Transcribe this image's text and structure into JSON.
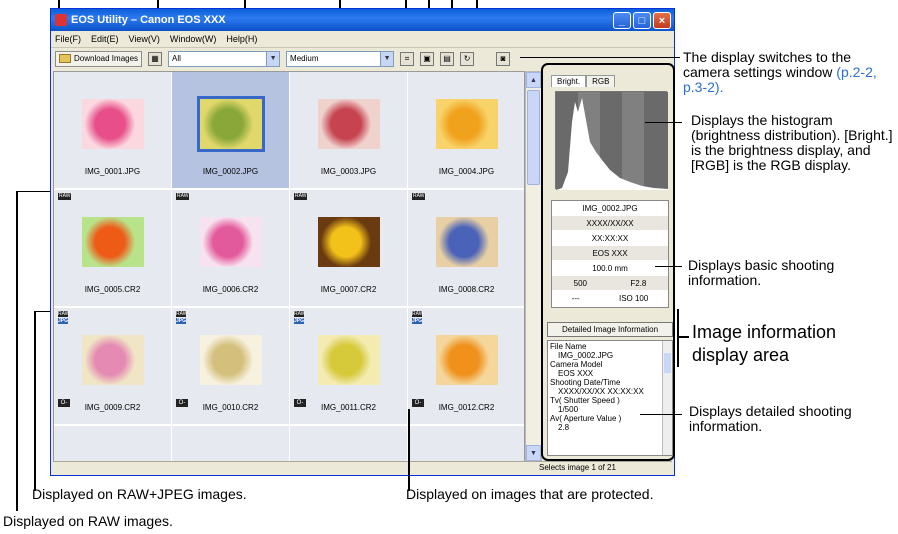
{
  "window": {
    "title": "EOS Utility – Canon EOS XXX",
    "controls": [
      "_",
      "□",
      "×"
    ]
  },
  "menu": [
    "File(F)",
    "Edit(E)",
    "View(V)",
    "Window(W)",
    "Help(H)"
  ],
  "toolbar": {
    "download_label": "Download Images",
    "filter_value": "All",
    "size_value": "Medium"
  },
  "thumbnails": [
    {
      "file": "IMG_0001.JPG",
      "badge": "",
      "lock": false,
      "selected": false,
      "colors": [
        "#e84f8a",
        "#fbd7e0"
      ]
    },
    {
      "file": "IMG_0002.JPG",
      "badge": "",
      "lock": false,
      "selected": true,
      "colors": [
        "#8aa83a",
        "#e0d86a"
      ]
    },
    {
      "file": "IMG_0003.JPG",
      "badge": "",
      "lock": false,
      "selected": false,
      "colors": [
        "#c6434f",
        "#f0d2cd"
      ]
    },
    {
      "file": "IMG_0004.JPG",
      "badge": "",
      "lock": false,
      "selected": false,
      "colors": [
        "#f0a21c",
        "#f7d36a"
      ]
    },
    {
      "file": "IMG_0005.CR2",
      "badge": "RAW",
      "lock": false,
      "selected": false,
      "colors": [
        "#ee5b17",
        "#b9e38a"
      ]
    },
    {
      "file": "IMG_0006.CR2",
      "badge": "RAW",
      "lock": false,
      "selected": false,
      "colors": [
        "#e35a9c",
        "#f7e3ef"
      ]
    },
    {
      "file": "IMG_0007.CR2",
      "badge": "RAW",
      "lock": false,
      "selected": false,
      "colors": [
        "#f2c11a",
        "#6a3a10"
      ]
    },
    {
      "file": "IMG_0008.CR2",
      "badge": "RAW",
      "lock": false,
      "selected": false,
      "colors": [
        "#4a63b8",
        "#e8d0a4"
      ]
    },
    {
      "file": "IMG_0009.CR2",
      "badge": "RAW+JPEG",
      "lock": true,
      "selected": false,
      "colors": [
        "#e58ab2",
        "#f0e6c6"
      ]
    },
    {
      "file": "IMG_0010.CR2",
      "badge": "RAW+JPEG",
      "lock": true,
      "selected": false,
      "colors": [
        "#d4c07c",
        "#f7f1df"
      ]
    },
    {
      "file": "IMG_0011.CR2",
      "badge": "RAW+JPEG",
      "lock": true,
      "selected": false,
      "colors": [
        "#d6c93a",
        "#f3ebb2"
      ]
    },
    {
      "file": "IMG_0012.CR2",
      "badge": "RAW+JPEG",
      "lock": true,
      "selected": false,
      "colors": [
        "#f0911c",
        "#f5d79b"
      ]
    },
    {
      "file": "",
      "badge": "",
      "lock": false,
      "selected": false,
      "colors": [
        "#e6e9ef",
        "#e6e9ef"
      ]
    },
    {
      "file": "",
      "badge": "",
      "lock": false,
      "selected": false,
      "colors": [
        "#e6e9ef",
        "#e6e9ef"
      ]
    },
    {
      "file": "",
      "badge": "",
      "lock": false,
      "selected": false,
      "colors": [
        "#e6e9ef",
        "#e6e9ef"
      ]
    },
    {
      "file": "",
      "badge": "",
      "lock": false,
      "selected": false,
      "colors": [
        "#e6e9ef",
        "#e6e9ef"
      ]
    }
  ],
  "status": "Selects image 1 of 21",
  "panel": {
    "tab_bright": "Bright.",
    "tab_rgb": "RGB",
    "basic_info": {
      "file": "IMG_0002.JPG",
      "date": "XXXX/XX/XX",
      "time": "XX:XX:XX",
      "model": "EOS XXX",
      "focal": "100.0 mm",
      "shutter": "500",
      "aperture": "F2.8",
      "dash": "---",
      "iso": "ISO 100"
    },
    "detail_button": "Detailed Image Information",
    "detail_lines": [
      {
        "text": "File Name",
        "indent": false
      },
      {
        "text": "IMG_0002.JPG",
        "indent": true
      },
      {
        "text": "Camera Model",
        "indent": false
      },
      {
        "text": "EOS XXX",
        "indent": true
      },
      {
        "text": "Shooting Date/Time",
        "indent": false
      },
      {
        "text": "XXXX/XX/XX XX:XX:XX",
        "indent": true
      },
      {
        "text": "Tv( Shutter Speed )",
        "indent": false
      },
      {
        "text": "1/500",
        "indent": true
      },
      {
        "text": "Av( Aperture Value )",
        "indent": false
      },
      {
        "text": "2.8",
        "indent": true
      }
    ]
  },
  "annotations": {
    "camera_settings": "The display switches to the camera settings window",
    "camera_settings_ref": "(p.2-2, p.3-2).",
    "histogram": "Displays the histogram (brightness distribution). [Bright.] is the brightness display, and [RGB] is the RGB display.",
    "basic_info": "Displays basic shooting information.",
    "info_area": "Image information display area",
    "detailed": "Displays detailed shooting information.",
    "raw_jpeg": "Displayed on RAW+JPEG images.",
    "protected": "Displayed on images that are protected.",
    "raw": "Displayed on RAW images."
  }
}
